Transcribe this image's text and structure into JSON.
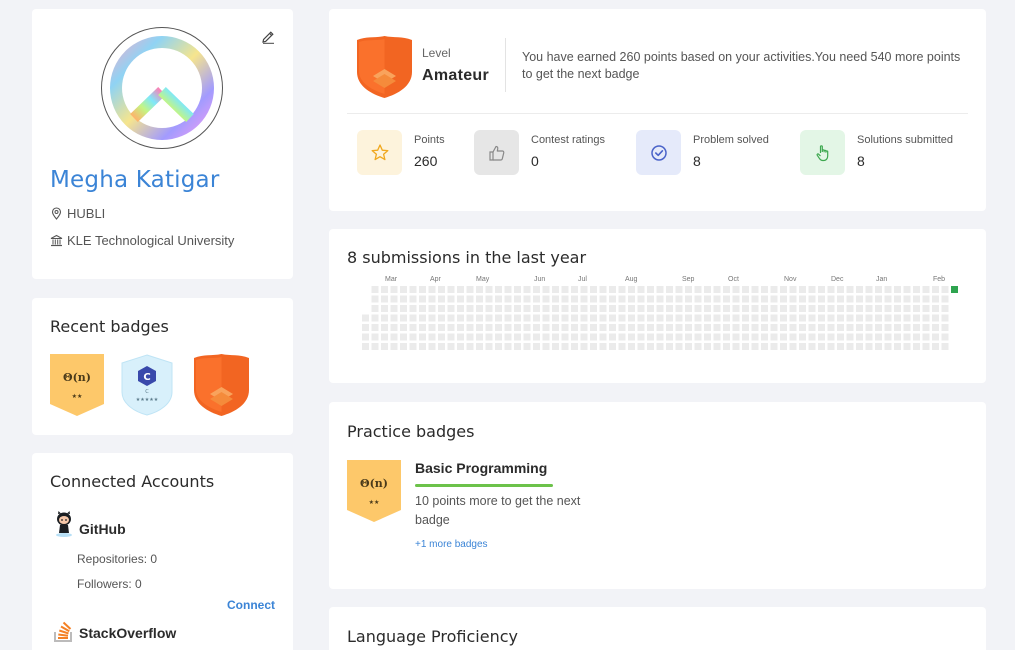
{
  "profile": {
    "name": "Megha Katigar",
    "location": "HUBLI",
    "university": "KLE Technological University"
  },
  "recent_badges": {
    "title": "Recent badges",
    "badges": [
      {
        "kind": "algorithm",
        "symbol": "Θ(n)",
        "stars": "★★"
      },
      {
        "kind": "language",
        "symbol": "C",
        "sub": "C",
        "stars": "★★★★★"
      },
      {
        "kind": "level"
      }
    ]
  },
  "connected": {
    "title": "Connected Accounts",
    "github": {
      "name": "GitHub",
      "repos": "Repositories: 0",
      "followers": "Followers: 0",
      "connect": "Connect"
    },
    "stackoverflow": {
      "name": "StackOverflow"
    }
  },
  "level": {
    "label": "Level",
    "value": "Amateur",
    "message": "You have earned 260 points based on your activities.You need 540 more points to get the next badge",
    "stats": [
      {
        "label": "Points",
        "value": "260",
        "icon": "star-icon",
        "color": "#fdf3dc"
      },
      {
        "label": "Contest ratings",
        "value": "0",
        "icon": "thumbs-up-icon",
        "color": "#e6e6e6"
      },
      {
        "label": "Problem solved",
        "value": "8",
        "icon": "check-circle-icon",
        "color": "#e5eafa"
      },
      {
        "label": "Solutions submitted",
        "value": "8",
        "icon": "pointer-hand-icon",
        "color": "#e3f6e6"
      }
    ]
  },
  "submissions": {
    "title": "8 submissions in the last year",
    "months": [
      "Mar",
      "Apr",
      "May",
      "Jun",
      "Jul",
      "Aug",
      "Sep",
      "Oct",
      "Nov",
      "Dec",
      "Jan",
      "Feb"
    ],
    "empty_color": "#ebebeb",
    "active_color": "#2ea44f"
  },
  "practice": {
    "title": "Practice badges",
    "badge_symbol": "Θ(n)",
    "badge_stars": "★★",
    "name": "Basic Programming",
    "message": "10 points more to get the next badge",
    "more": "+1 more badges"
  },
  "language": {
    "title": "Language Proficiency"
  },
  "colors": {
    "accent": "#3b84d6",
    "level_orange": "#f26522",
    "badge_gold": "#fdc86a",
    "progress_green": "#6cc24a"
  }
}
